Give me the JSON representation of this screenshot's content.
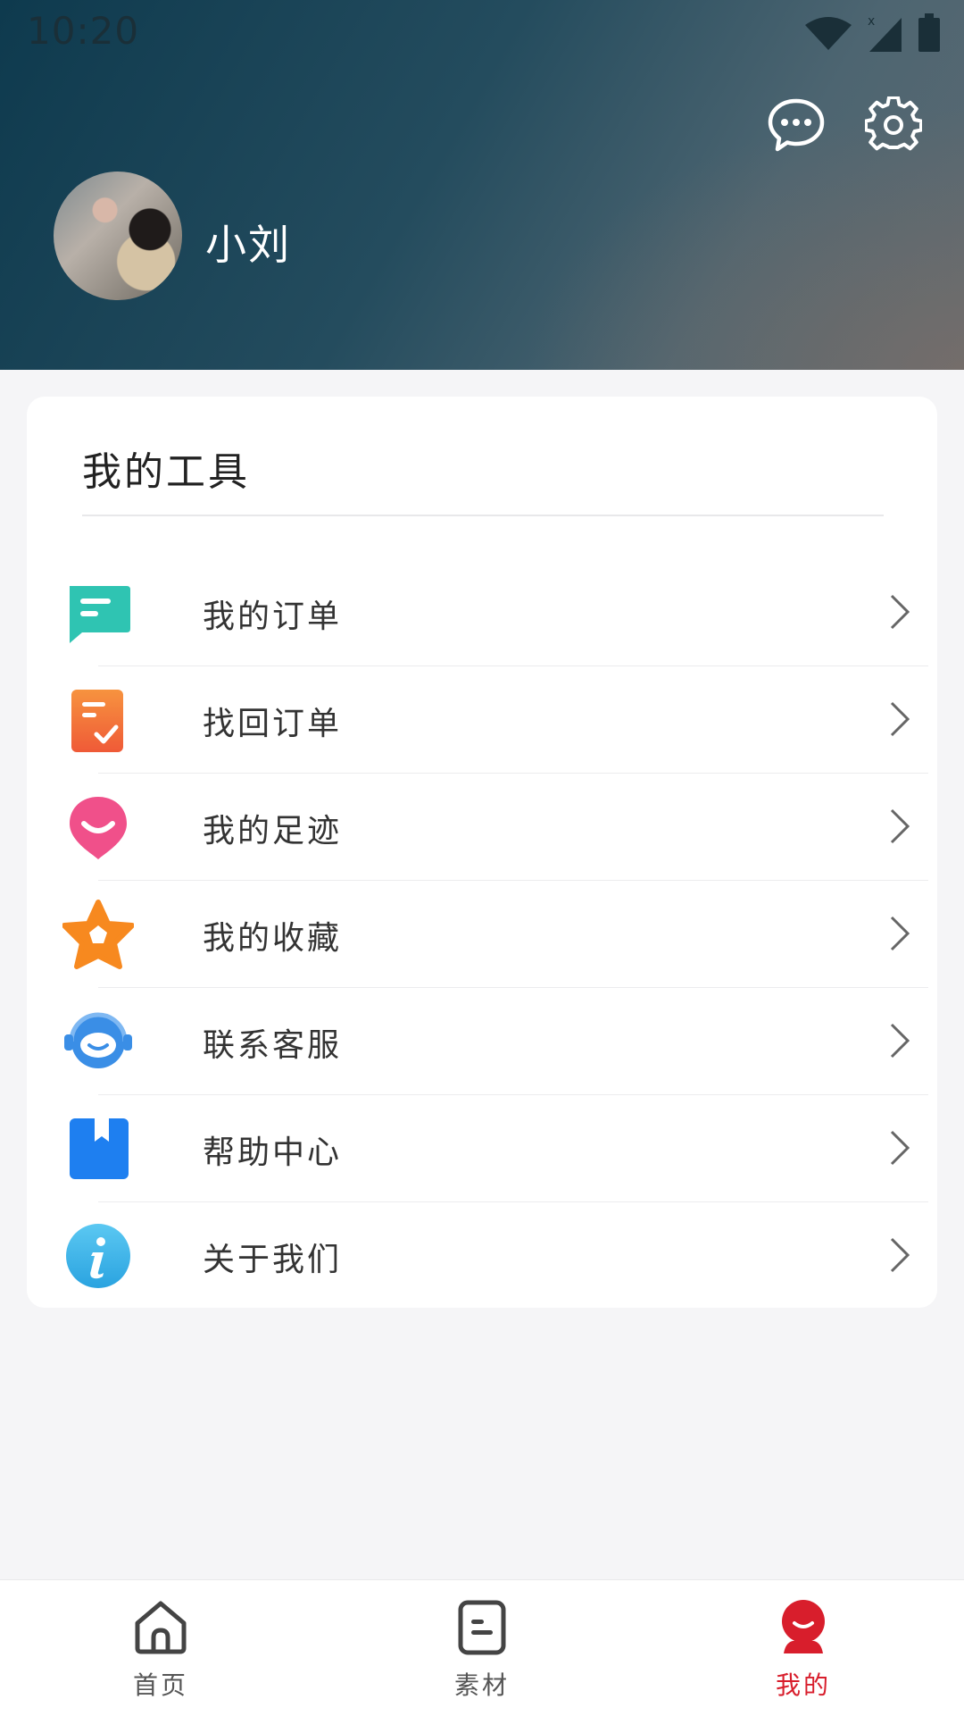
{
  "status_bar": {
    "time": "10:20"
  },
  "header": {
    "username": "小刘",
    "icons": [
      "message-icon",
      "settings-gear-icon"
    ]
  },
  "tools": {
    "title": "我的工具",
    "items": [
      {
        "label": "我的订单",
        "icon": "order-chat-icon",
        "color": "#2fc4b2"
      },
      {
        "label": "找回订单",
        "icon": "clipboard-check-icon",
        "color": "#f26a3d"
      },
      {
        "label": "我的足迹",
        "icon": "footprint-pin-icon",
        "color": "#f0508a"
      },
      {
        "label": "我的收藏",
        "icon": "star-icon",
        "color": "#f7891f"
      },
      {
        "label": "联系客服",
        "icon": "customer-service-headset-icon",
        "color": "#3a8ee6"
      },
      {
        "label": "帮助中心",
        "icon": "help-bookmark-icon",
        "color": "#1e7ff0"
      },
      {
        "label": "关于我们",
        "icon": "info-icon",
        "color": "#2aaee8"
      }
    ]
  },
  "tabbar": {
    "tabs": [
      {
        "label": "首页",
        "icon": "home-icon",
        "active": false
      },
      {
        "label": "素材",
        "icon": "document-icon",
        "active": false
      },
      {
        "label": "我的",
        "icon": "profile-icon",
        "active": true
      }
    ],
    "accent_color": "#d81e2c"
  }
}
